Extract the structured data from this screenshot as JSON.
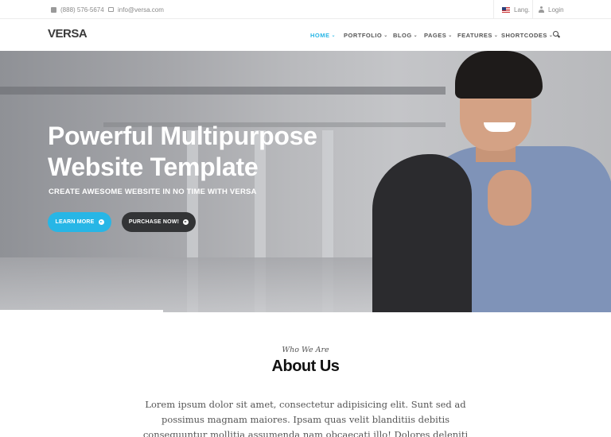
{
  "topbar": {
    "phone": "(888) 576-5674",
    "email": "info@versa.com",
    "lang": "Lang.",
    "login": "Login"
  },
  "header": {
    "logo": "VERSA",
    "nav": [
      "HOME",
      "PORTFOLIO",
      "BLOG",
      "PAGES",
      "FEATURES",
      "SHORTCODES"
    ],
    "active_color": "#27b6e6"
  },
  "hero": {
    "title_line1": "Powerful Multipurpose",
    "title_line2": "Website Template",
    "subtitle": "CREATE AWESOME WEBSITE IN NO TIME WITH VERSA",
    "learn_more": "LEARN MORE",
    "purchase": "PURCHASE NOW!",
    "accent": "#27b6e6",
    "dark_button": "#333436"
  },
  "about": {
    "kicker": "Who We Are",
    "title": "About Us",
    "text": "Lorem ipsum dolor sit amet, consectetur adipisicing elit. Sunt sed ad possimus magnam maiores. Ipsam quas velit blanditiis debitis consequuntur mollitia assumenda nam obcaecati illo! Dolores deleniti"
  },
  "icons": [
    "phone-icon",
    "mail-icon",
    "flag-icon",
    "user-icon",
    "search-icon",
    "arrow-circle-icon"
  ]
}
